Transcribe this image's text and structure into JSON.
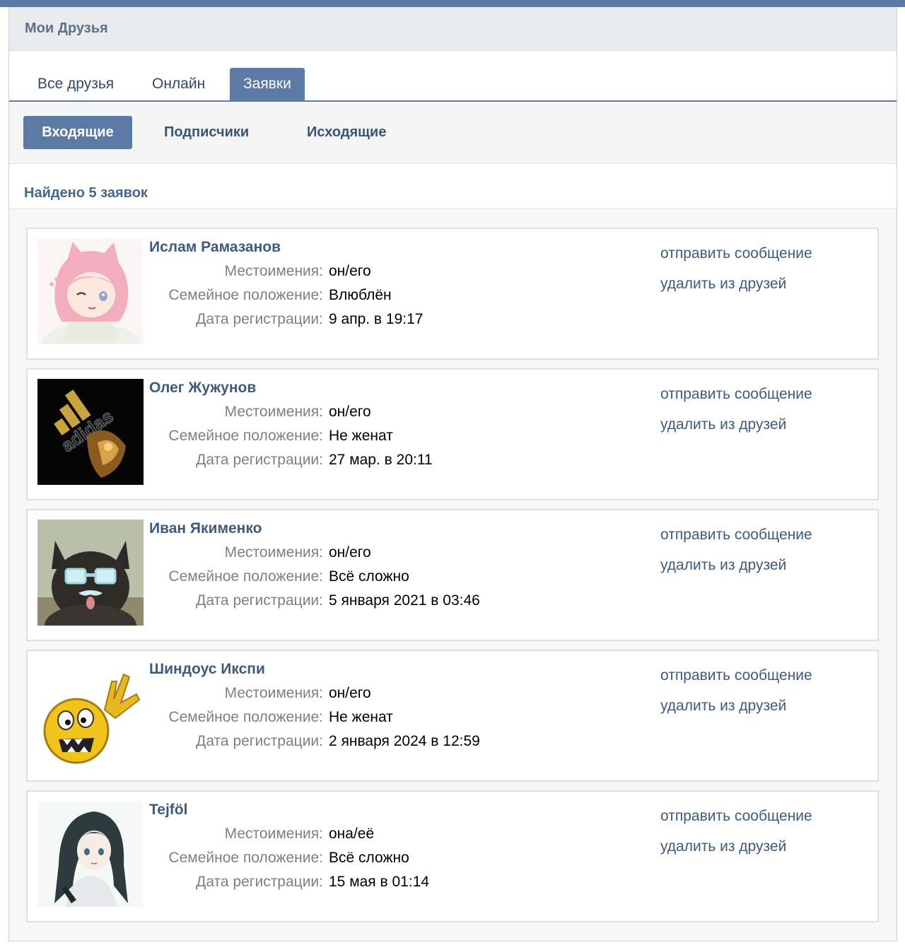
{
  "header": {
    "title": "Мои Друзья"
  },
  "tabs": [
    {
      "label": "Все друзья"
    },
    {
      "label": "Онлайн"
    },
    {
      "label": "Заявки"
    }
  ],
  "subtabs": [
    {
      "label": "Входящие"
    },
    {
      "label": "Подписчики"
    },
    {
      "label": "Исходящие"
    }
  ],
  "found": "Найдено 5 заявок",
  "labels": {
    "pronouns": "Местоимения:",
    "family": "Семейное положение:",
    "registered": "Дата регистрации:"
  },
  "actions": {
    "message": "отправить сообщение",
    "remove": "удалить из друзей"
  },
  "requests": [
    {
      "name": "Ислам Рамазанов",
      "pronouns": "он/его",
      "family": "Влюблён",
      "registered": "9 апр. в 19:17",
      "avatar": "anime-catgirl-avatar"
    },
    {
      "name": "Олег Жужунов",
      "pronouns": "он/его",
      "family": "Не женат",
      "registered": "27 мар. в 20:11",
      "avatar": "adidas-logo-avatar"
    },
    {
      "name": "Иван Якименко",
      "pronouns": "он/его",
      "family": "Всё сложно",
      "registered": "5 января 2021 в 03:46",
      "avatar": "cat-with-glasses-avatar"
    },
    {
      "name": "Шиндоус Икспи",
      "pronouns": "он/его",
      "family": "Не женат",
      "registered": "2 января 2024 в 12:59",
      "avatar": "yellow-smiley-avatar"
    },
    {
      "name": "Tejföl",
      "pronouns": "она/её",
      "family": "Всё сложно",
      "registered": "15 мая в 01:14",
      "avatar": "anime-girl-avatar"
    }
  ],
  "colors": {
    "accent": "#5b7aa6",
    "link": "#3d5a80",
    "label": "#7f7f7f"
  }
}
